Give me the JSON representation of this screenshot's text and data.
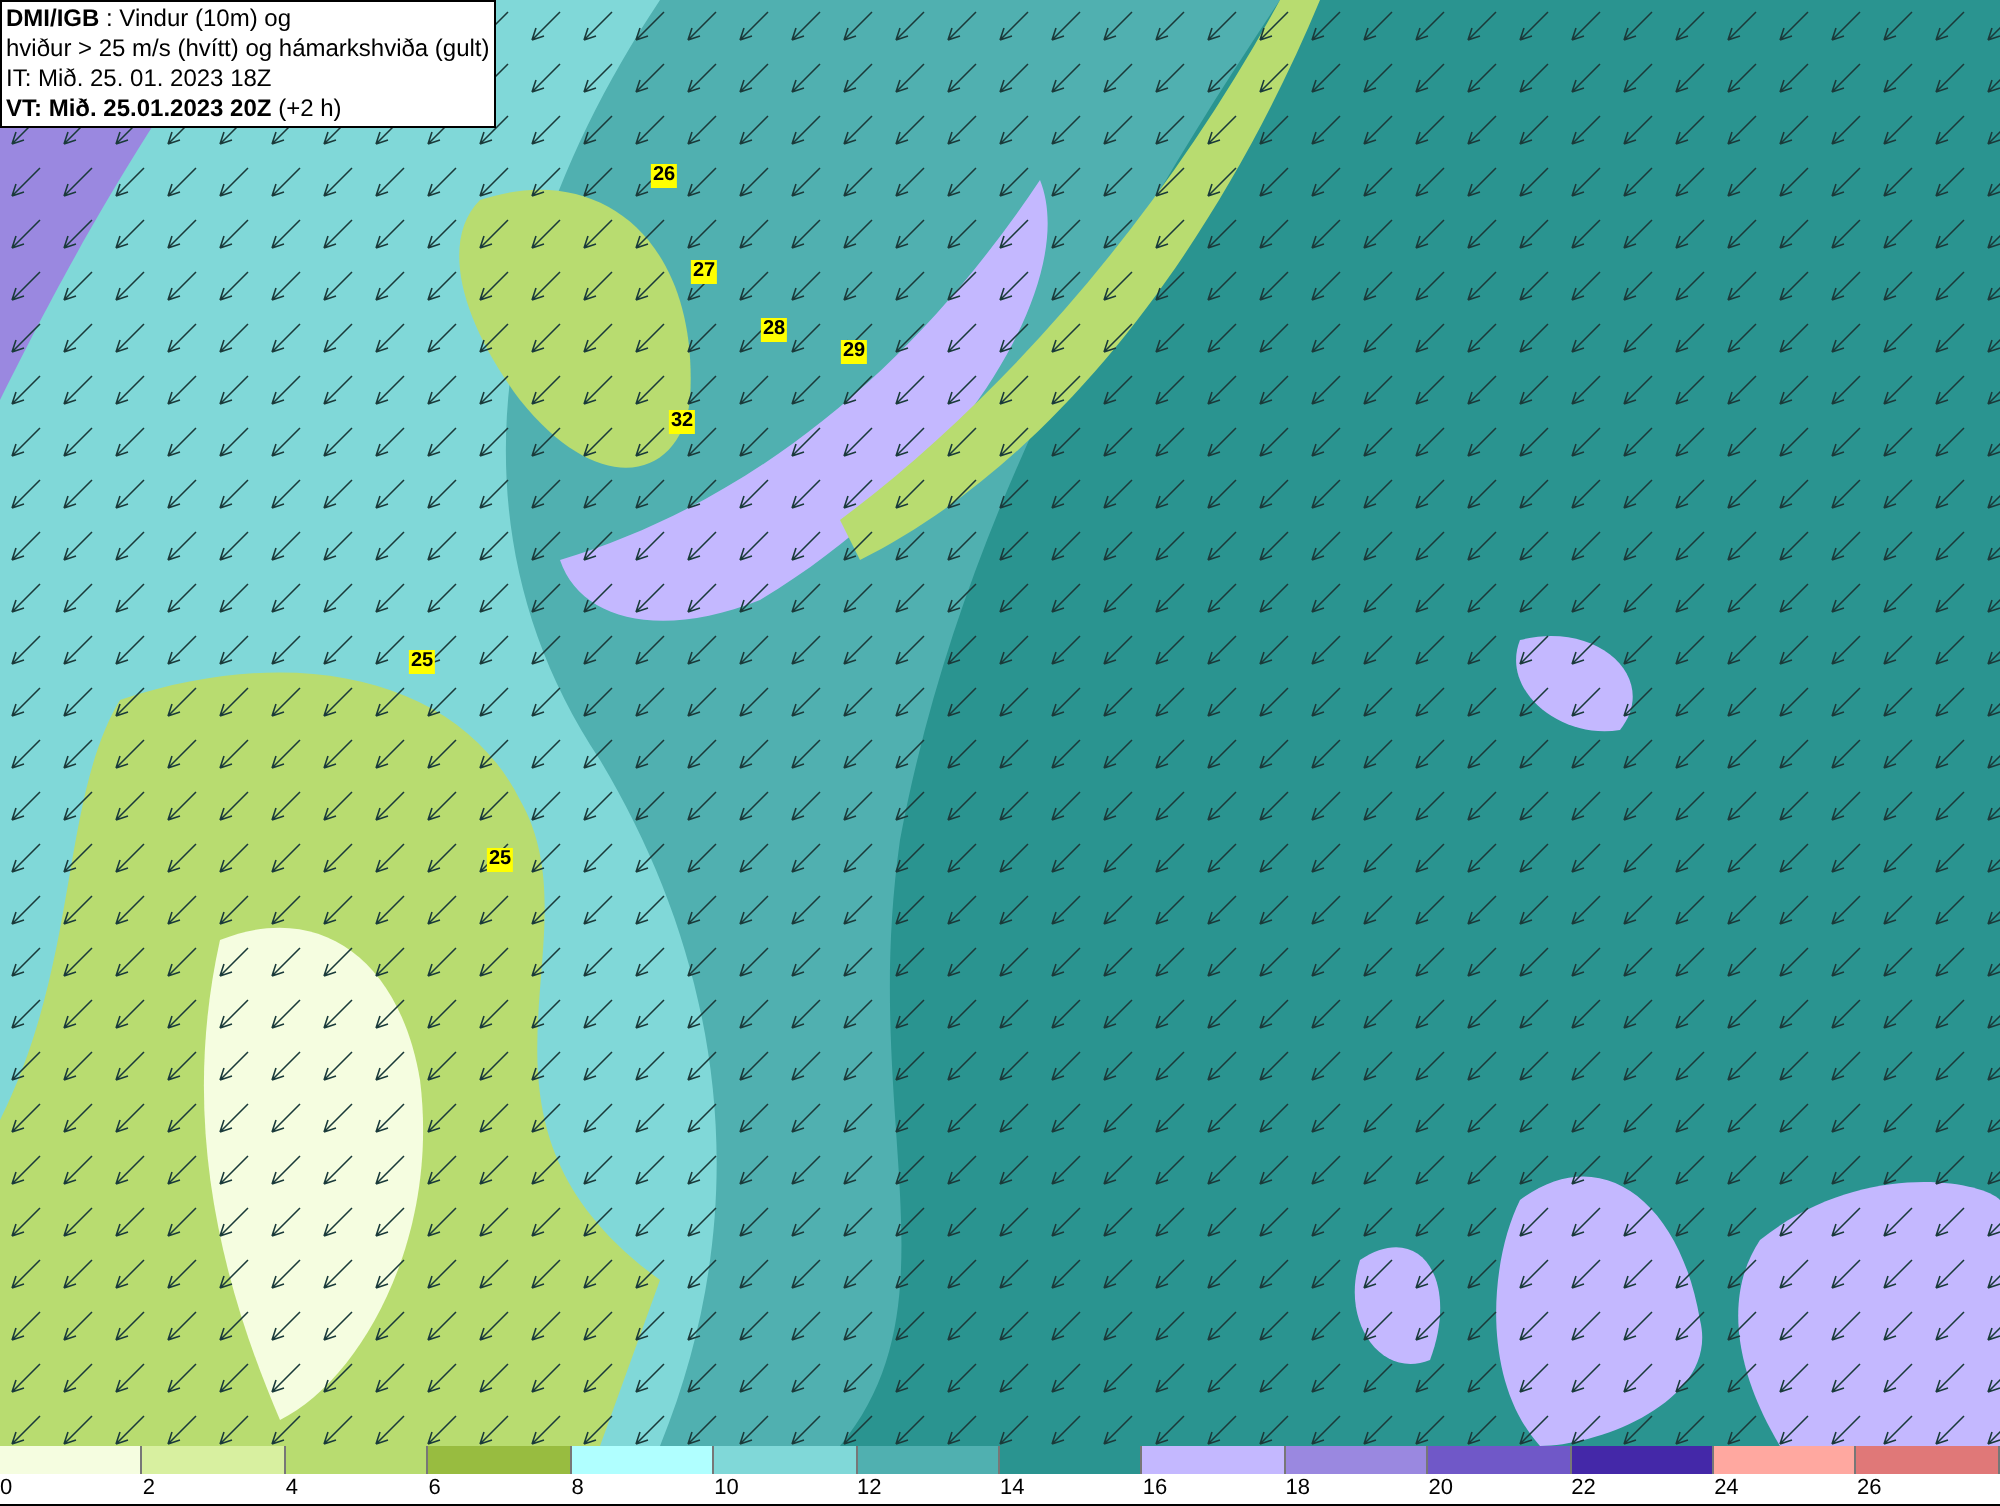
{
  "header": {
    "lines": [
      "**DMI/IGB** : Vindur (10m) og",
      "hviður > 25 m/s (hvítt) og hámarkshviða (gult)",
      "IT: Mið. 25. 01. 2023 18Z",
      "**VT: Mið. 25.01.2023 20Z** (+2 h)"
    ]
  },
  "gust_labels": [
    "26",
    "27",
    "28",
    "29",
    "32",
    "25",
    "25"
  ],
  "legend": [
    {
      "label": "0",
      "color": "#f5fde0"
    },
    {
      "label": "2",
      "color": "#d8f0a0"
    },
    {
      "label": "4",
      "color": "#b8dc70"
    },
    {
      "label": "6",
      "color": "#98bc40"
    },
    {
      "label": "8",
      "color": "#b0ffff"
    },
    {
      "label": "10",
      "color": "#80d8d8"
    },
    {
      "label": "12",
      "color": "#50b0b0"
    },
    {
      "label": "14",
      "color": "#2a9490"
    },
    {
      "label": "16",
      "color": "#c4b8ff"
    },
    {
      "label": "18",
      "color": "#9a88e0"
    },
    {
      "label": "20",
      "color": "#7058c8"
    },
    {
      "label": "22",
      "color": "#4428a8"
    },
    {
      "label": "24",
      "color": "#ffa8a0"
    },
    {
      "label": "26",
      "color": "#e07878"
    }
  ]
}
